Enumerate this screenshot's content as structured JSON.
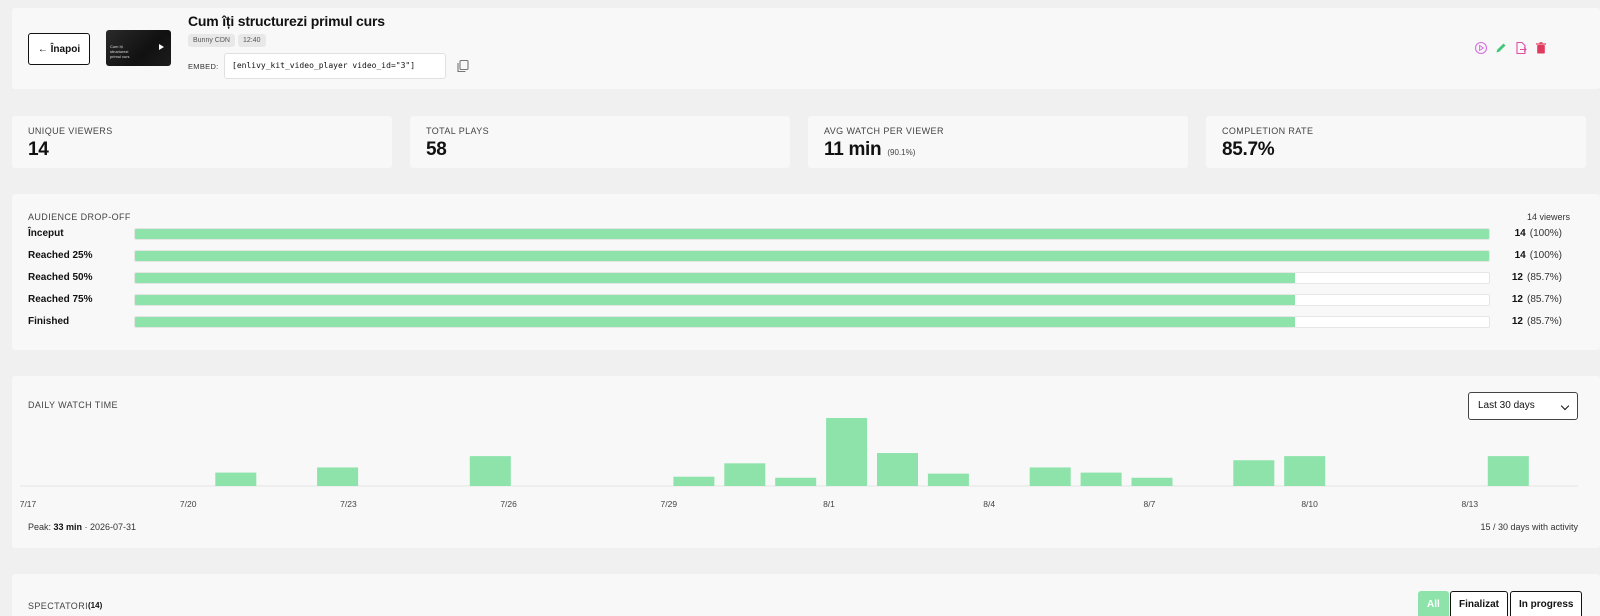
{
  "header": {
    "back_label": "← Înapoi",
    "thumbnail_text": "Cum îți structurezi primul curs",
    "title": "Cum îți structurezi primul curs",
    "provider_badge": "Bunny CDN",
    "duration_badge": "12:40",
    "embed_label": "EMBED:",
    "embed_code": "[enlivy_kit_video_player video_id=\"3\"]",
    "actions": [
      {
        "icon": "play-circle-icon",
        "color": "#d56ee0"
      },
      {
        "icon": "pencil-icon",
        "color": "#3fc77a"
      },
      {
        "icon": "file-export-icon",
        "color": "#e04fa6"
      },
      {
        "icon": "trash-icon",
        "color": "#e03a5e"
      }
    ]
  },
  "stats": [
    {
      "label": "UNIQUE VIEWERS",
      "value": "14",
      "sub": ""
    },
    {
      "label": "TOTAL PLAYS",
      "value": "58",
      "sub": ""
    },
    {
      "label": "AVG WATCH PER VIEWER",
      "value": "11 min",
      "sub": "(90.1%)"
    },
    {
      "label": "COMPLETION RATE",
      "value": "85.7%",
      "sub": ""
    }
  ],
  "dropoff": {
    "title": "AUDIENCE DROP-OFF",
    "total": "14 viewers",
    "rows": [
      {
        "label": "Început",
        "count": "14",
        "pct": "(100%)",
        "fraction": 1.0
      },
      {
        "label": "Reached 25%",
        "count": "14",
        "pct": "(100%)",
        "fraction": 1.0
      },
      {
        "label": "Reached 50%",
        "count": "12",
        "pct": "(85.7%)",
        "fraction": 0.857
      },
      {
        "label": "Reached 75%",
        "count": "12",
        "pct": "(85.7%)",
        "fraction": 0.857
      },
      {
        "label": "Finished",
        "count": "12",
        "pct": "(85.7%)",
        "fraction": 0.857
      }
    ]
  },
  "daily": {
    "title": "DAILY WATCH TIME",
    "range": "Last 30 days",
    "peak_prefix": "Peak: ",
    "peak_value": "33 min",
    "peak_date": " · 2026-07-31",
    "active_days": "15 / 30 days with activity"
  },
  "chart_data": {
    "type": "bar",
    "categories": [
      "7/17",
      "7/18",
      "7/19",
      "7/20",
      "7/21",
      "7/22",
      "7/23",
      "7/24",
      "7/25",
      "7/26",
      "7/27",
      "7/28",
      "7/29",
      "7/30",
      "7/31",
      "8/1",
      "8/2",
      "8/3",
      "8/4",
      "8/5",
      "8/6",
      "8/7",
      "8/8",
      "8/9",
      "8/10",
      "8/11",
      "8/12",
      "8/13",
      "8/14"
    ],
    "tick_labels": [
      "7/17",
      "7/20",
      "7/23",
      "7/26",
      "7/29",
      "8/1",
      "8/4",
      "8/7",
      "8/10",
      "8/13"
    ],
    "values": [
      0,
      0,
      6.5,
      0,
      9,
      0,
      0,
      14.5,
      0,
      0,
      0,
      4.5,
      11,
      4,
      33,
      16,
      6,
      0,
      9,
      6.5,
      4,
      0,
      12.5,
      14.5,
      0,
      0,
      0,
      14.5,
      0
    ],
    "ylabel": "",
    "xlabel": "",
    "color": "#8de3aa"
  },
  "viewers": {
    "title": "SPECTATORI",
    "count": "(14)",
    "filters": [
      {
        "label": "All",
        "active": true
      },
      {
        "label": "Finalizat",
        "active": false
      },
      {
        "label": "In progress",
        "active": false
      }
    ]
  }
}
